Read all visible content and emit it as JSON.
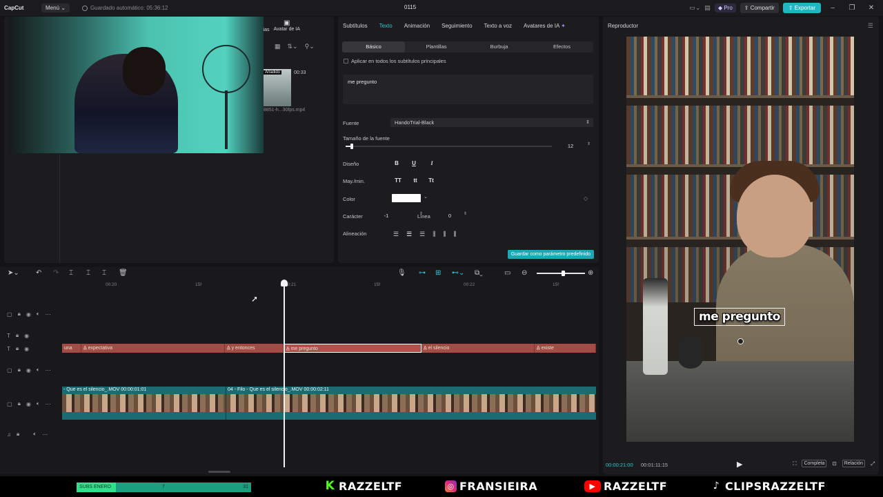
{
  "titlebar": {
    "logo": "CapCut",
    "menu_label": "Menú ⌄",
    "autosave": "Guardado automático: 05:36:12",
    "project_title": "0115",
    "pro_label": "Pro",
    "share_label": "Compartir",
    "export_label": "Exportar"
  },
  "media": {
    "tab_partial": "lias",
    "tab_avatar": "Avatar de IA",
    "thumb_badge": "Añadido",
    "thumb_duration": "00:33",
    "thumb_name": "8851-h...30fps.mp4"
  },
  "properties": {
    "tabs": [
      "Subtítulos",
      "Texto",
      "Animación",
      "Seguimiento",
      "Texto a voz",
      "Avatares de IA"
    ],
    "active_tab": "Texto",
    "subtabs": [
      "Básico",
      "Plantillas",
      "Burbuja",
      "Efectos"
    ],
    "apply_all_label": "Aplicar en todos los subtítulos principales",
    "text_value": "me pregunto",
    "font_label": "Fuente",
    "font_value": "HandoTrial-Black",
    "size_label": "Tamaño de la fuente",
    "size_value": "12",
    "size_fraction": 0.03,
    "design_label": "Diseño",
    "design_buttons": [
      "B",
      "U",
      "I"
    ],
    "case_label": "May./min.",
    "case_buttons": [
      "TT",
      "tt",
      "Tt"
    ],
    "color_label": "Color",
    "color_value": "#ffffff",
    "char_label": "Carácter",
    "char_value": "-1",
    "line_label": "Línea",
    "line_value": "0",
    "align_label": "Alineación",
    "save_preset_label": "Guardar como parámetro predefinido"
  },
  "player": {
    "title": "Reproductor",
    "caption": "me pregunto",
    "time_current": "00:00:21:00",
    "time_total": "00:01:11:15",
    "full_label": "Completa",
    "ratio_label": "Relación"
  },
  "timeline": {
    "ruler": [
      "00:20",
      "15f",
      "00:21",
      "15f",
      "00:22",
      "15f"
    ],
    "text_clips": [
      "una",
      "A̲ expectativa",
      "A̲ y entonces",
      "A̲ me pregunto",
      "A̲ el silencio",
      "A̲ existe"
    ],
    "video_clips": [
      "- Que es el silencio_.MOV  00:00:01:01",
      "04 - Filo - Que es el silencio_.MOV  00:00:02:11"
    ]
  },
  "overlay": {
    "subs_label": "SUBS ENERO",
    "subs_current": "7",
    "subs_goal": "31",
    "subs_fraction": 0.226,
    "kick": "RAZZELTF",
    "instagram": "FRANSIEIRA",
    "youtube": "RAZZELTF",
    "tiktok": "CLIPSRAZZELTF",
    "colors": {
      "kick": "#53fc18",
      "youtube": "#ff0000",
      "accent": "#31c5d1"
    }
  }
}
